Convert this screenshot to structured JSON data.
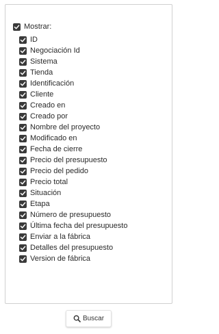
{
  "filter": {
    "master_label": "Mostrar:",
    "master_checked": true,
    "items": [
      {
        "label": "ID",
        "checked": true
      },
      {
        "label": "Negociación Id",
        "checked": true
      },
      {
        "label": "Sistema",
        "checked": true
      },
      {
        "label": "Tienda",
        "checked": true
      },
      {
        "label": "Identificación",
        "checked": true
      },
      {
        "label": "Cliente",
        "checked": true
      },
      {
        "label": "Creado en",
        "checked": true
      },
      {
        "label": "Creado por",
        "checked": true
      },
      {
        "label": "Nombre del proyecto",
        "checked": true
      },
      {
        "label": "Modificado en",
        "checked": true
      },
      {
        "label": "Fecha de cierre",
        "checked": true
      },
      {
        "label": "Precio del presupuesto",
        "checked": true
      },
      {
        "label": "Precio del pedido",
        "checked": true
      },
      {
        "label": "Precio total",
        "checked": true
      },
      {
        "label": "Situación",
        "checked": true
      },
      {
        "label": "Etapa",
        "checked": true
      },
      {
        "label": "Número de presupuesto",
        "checked": true
      },
      {
        "label": "Última fecha del presupuesto",
        "checked": true
      },
      {
        "label": "Enviar a la fábrica",
        "checked": true
      },
      {
        "label": "Detalles del presupuesto",
        "checked": true
      },
      {
        "label": "Version de fábrica",
        "checked": true
      }
    ]
  },
  "search_button": {
    "label": "Buscar",
    "icon": "search-icon"
  },
  "colors": {
    "checkbox_fill": "#3a3a3a",
    "text": "#2a2a2a",
    "panel_border": "#d0d0d0"
  }
}
